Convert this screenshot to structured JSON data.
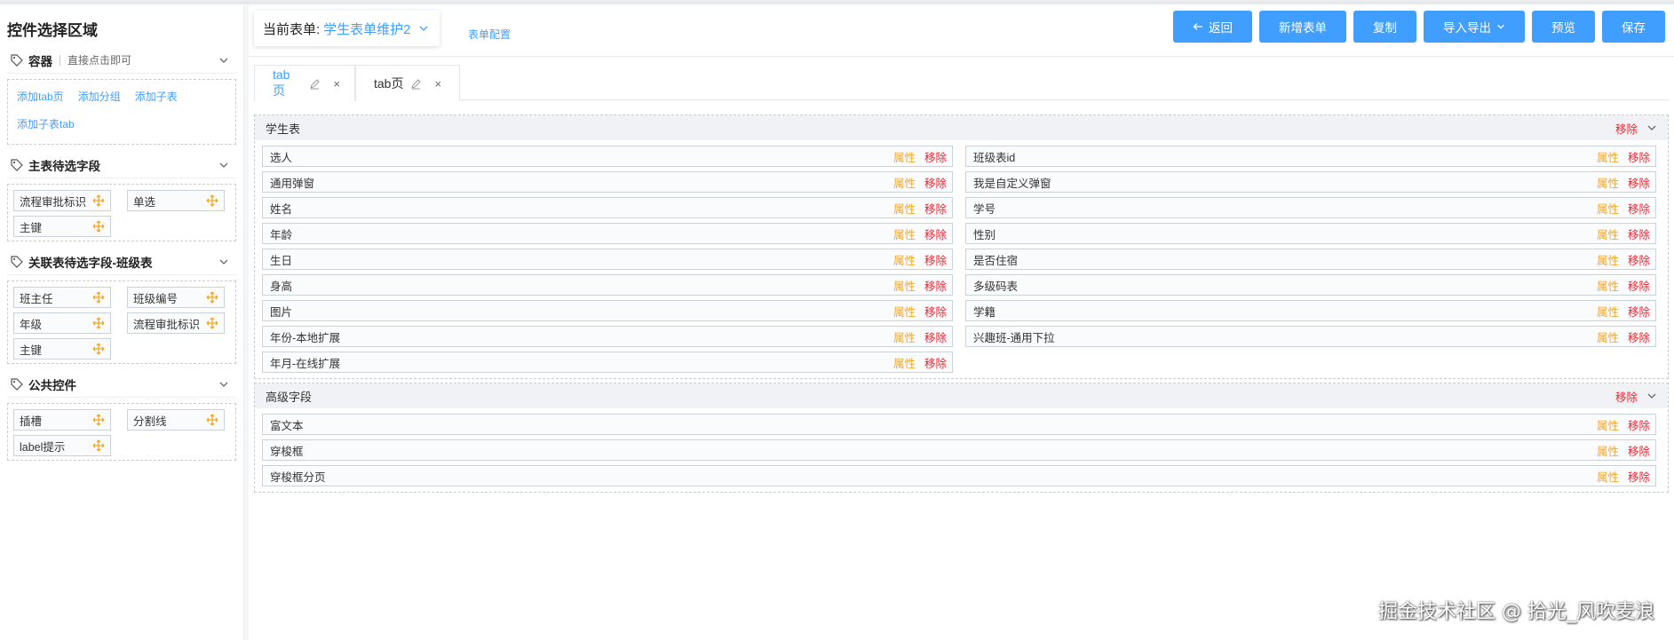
{
  "sidebar": {
    "title": "控件选择区域",
    "groups": [
      {
        "title": "容器",
        "hint": "直接点击即可",
        "links": [
          "添加tab页",
          "添加分组",
          "添加子表",
          "添加子表tab"
        ]
      },
      {
        "title": "主表待选字段",
        "fields": [
          "流程审批标识",
          "单选",
          "主键"
        ]
      },
      {
        "title": "关联表待选字段-班级表",
        "fields": [
          "班主任",
          "班级编号",
          "年级",
          "流程审批标识",
          "主键"
        ]
      },
      {
        "title": "公共控件",
        "fields": [
          "插槽",
          "分割线",
          "label提示"
        ]
      }
    ]
  },
  "toolbar": {
    "current_form_label": "当前表单:",
    "current_form_value": "学生表单维护2",
    "form_config": "表单配置",
    "buttons": {
      "back": "返回",
      "new_form": "新增表单",
      "copy": "复制",
      "import_export": "导入导出",
      "preview": "预览",
      "save": "保存"
    }
  },
  "tabs": [
    {
      "label": "tab页",
      "active": true
    },
    {
      "label": "tab页",
      "active": false
    }
  ],
  "sections": [
    {
      "title": "学生表",
      "remove": "移除",
      "left": [
        "选人",
        "通用弹窗",
        "姓名",
        "年龄",
        "生日",
        "身高",
        "图片",
        "年份-本地扩展",
        "年月-在线扩展"
      ],
      "right": [
        "班级表id",
        "我是自定义弹窗",
        "学号",
        "性别",
        "是否住宿",
        "多级码表",
        "学籍",
        "兴趣班-通用下拉"
      ]
    },
    {
      "title": "高级字段",
      "remove": "移除",
      "rows": [
        "富文本",
        "穿梭框",
        "穿梭框分页"
      ]
    }
  ],
  "row_actions": {
    "attr": "属性",
    "remove": "移除"
  },
  "colors": {
    "primary": "#409eff",
    "attr": "#f5a623",
    "remove": "#f5222d"
  },
  "watermark": "掘金技术社区 @ 拾光_风吹麦浪"
}
